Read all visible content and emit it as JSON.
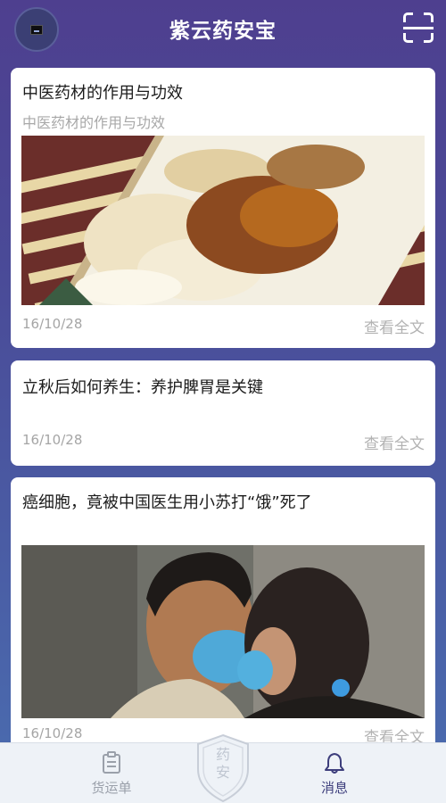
{
  "header": {
    "title": "紫云药安宝"
  },
  "articles": [
    {
      "title": "中医药材的作用与功效",
      "subtitle": "中医药材的作用与功效",
      "date": "16/10/28",
      "more": "查看全文"
    },
    {
      "title": "立秋后如何养生：养护脾胃是关键",
      "date": "16/10/28",
      "more": "查看全文"
    },
    {
      "title": "癌细胞，竟被中国医生用小苏打“饿”死了",
      "date": "16/10/28",
      "more": "查看全文"
    }
  ],
  "tabbar": {
    "goods_label": "货运单",
    "center_badge_text": "药安",
    "message_label": "消息"
  },
  "colors": {
    "header_gradient_top": "#4e3f8f",
    "header_gradient_bottom": "#4a6db0",
    "active_tab": "#3d3e7c",
    "inactive_tab": "#9aa0aa"
  },
  "icons": {
    "scan": "scan-icon",
    "goods": "clipboard-icon",
    "message": "bell-icon",
    "center": "shield-badge-icon"
  }
}
